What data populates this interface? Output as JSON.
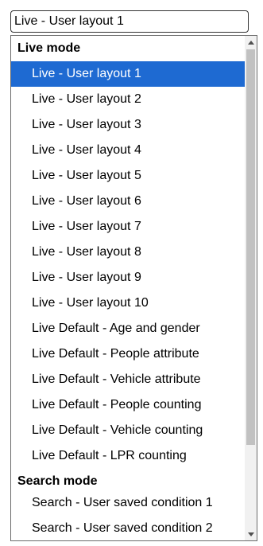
{
  "select": {
    "value": "Live - User layout 1"
  },
  "groups": [
    {
      "label": "Live mode"
    },
    {
      "label": "Search mode"
    }
  ],
  "live_options": [
    {
      "label": "Live - User layout 1",
      "selected": true
    },
    {
      "label": "Live - User layout 2"
    },
    {
      "label": "Live - User layout 3"
    },
    {
      "label": "Live - User layout 4"
    },
    {
      "label": "Live - User layout 5"
    },
    {
      "label": "Live - User layout 6"
    },
    {
      "label": "Live - User layout 7"
    },
    {
      "label": "Live - User layout 8"
    },
    {
      "label": "Live - User layout 9"
    },
    {
      "label": "Live - User layout 10"
    },
    {
      "label": "Live Default - Age and gender"
    },
    {
      "label": "Live Default - People attribute"
    },
    {
      "label": "Live Default - Vehicle attribute"
    },
    {
      "label": "Live Default - People counting"
    },
    {
      "label": "Live Default - Vehicle counting"
    },
    {
      "label": "Live Default - LPR counting"
    }
  ],
  "search_options": [
    {
      "label": "Search - User saved condition 1"
    },
    {
      "label": "Search - User saved condition 2"
    }
  ],
  "colors": {
    "selected_bg": "#1e6ad2",
    "selected_fg": "#ffffff",
    "scroll_thumb": "#c1c1c1"
  },
  "icons": {
    "scroll_up": "triangle-up",
    "scroll_down": "triangle-down"
  }
}
